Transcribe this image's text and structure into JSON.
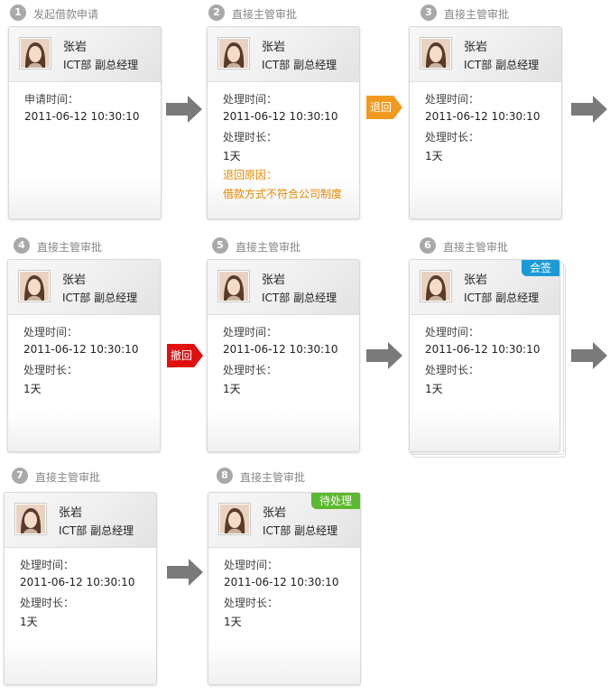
{
  "colors": {
    "gray_arrow": "#7a7a7a",
    "return_tag": "#f29a1e",
    "withdraw_tag": "#e01010",
    "countersign_badge": "#1a9bd6",
    "pending_badge": "#5cb82e",
    "warn_text": "#e68a00"
  },
  "steps": [
    {
      "num": "1",
      "title": "发起借款申请",
      "name": "张岩",
      "role": "ICT部 副总经理",
      "lines": [
        "申请时间：",
        "2011-06-12 10:30:10"
      ]
    },
    {
      "num": "2",
      "title": "直接主管审批",
      "name": "张岩",
      "role": "ICT部 副总经理",
      "lines": [
        "处理时间：",
        "2011-06-12 10:30:10",
        "处理时长：",
        "1天",
        "退回原因：",
        "借款方式不符合公司制度"
      ]
    },
    {
      "num": "3",
      "title": "直接主管审批",
      "name": "张岩",
      "role": "ICT部 副总经理",
      "lines": [
        "处理时间：",
        "2011-06-12 10:30:10",
        "处理时长：",
        "1天"
      ]
    },
    {
      "num": "4",
      "title": "直接主管审批",
      "name": "张岩",
      "role": "ICT部 副总经理",
      "lines": [
        "处理时间：",
        "2011-06-12 10:30:10",
        "处理时长：",
        "1天"
      ]
    },
    {
      "num": "5",
      "title": "直接主管审批",
      "name": "张岩",
      "role": "ICT部 副总经理",
      "lines": [
        "处理时间：",
        "2011-06-12 10:30:10",
        "处理时长：",
        "1天"
      ]
    },
    {
      "num": "6",
      "title": "直接主管审批",
      "name": "张岩",
      "role": "ICT部 副总经理",
      "lines": [
        "处理时间：",
        "2011-06-12 10:30:10",
        "处理时长：",
        "1天"
      ],
      "badge": "会签"
    },
    {
      "num": "7",
      "title": "直接主管审批",
      "name": "张岩",
      "role": "ICT部 副总经理",
      "lines": [
        "处理时间：",
        "2011-06-12 10:30:10",
        "处理时长：",
        "1天"
      ]
    },
    {
      "num": "8",
      "title": "直接主管审批",
      "name": "张岩",
      "role": "ICT部 副总经理",
      "lines": [
        "处理时间：",
        "2011-06-12 10:30:10",
        "处理时长：",
        "1天"
      ],
      "badge": "待处理"
    }
  ],
  "transitions": {
    "return_label": "退回",
    "withdraw_label": "撤回"
  },
  "icons": {
    "arrow": "arrow-right-icon",
    "avatar": "user-avatar"
  }
}
